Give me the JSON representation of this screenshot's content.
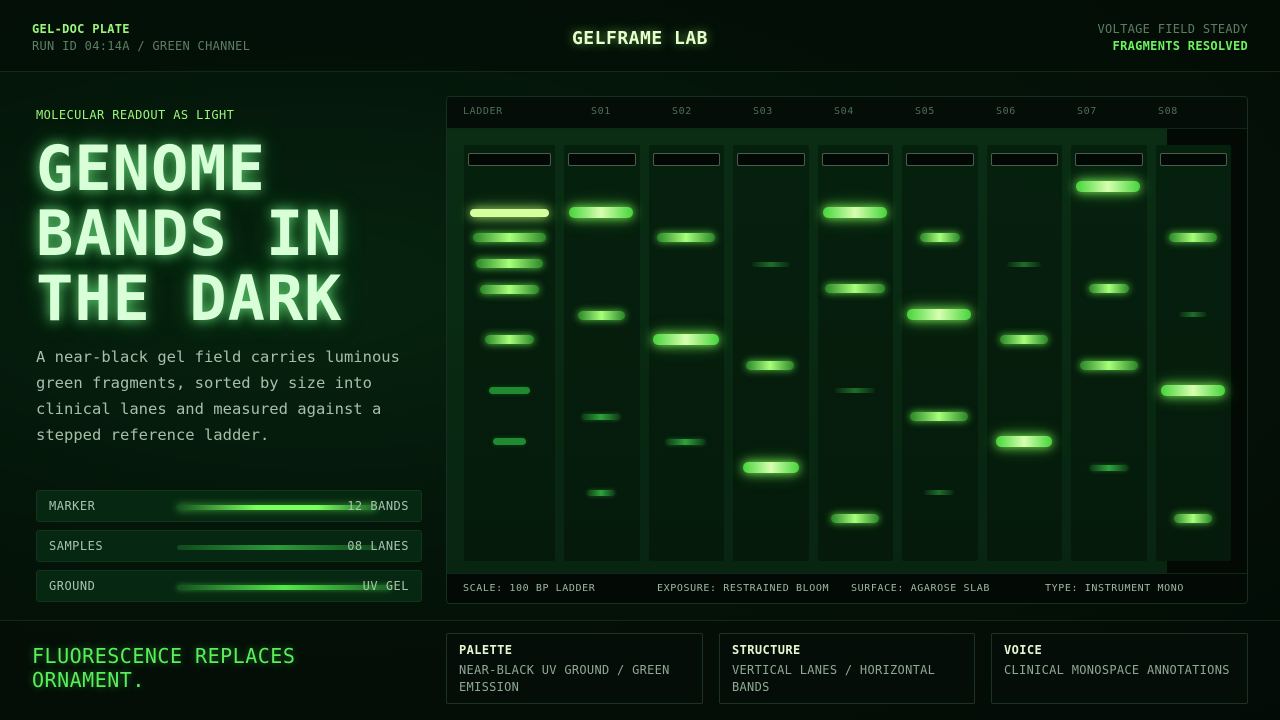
{
  "header": {
    "plate_label": "GEL-DOC PLATE",
    "run_id": "RUN ID 04:14A / GREEN CHANNEL",
    "brand": "GELFRAME LAB",
    "status_1": "VOLTAGE FIELD STEADY",
    "status_2": "FRAGMENTS RESOLVED"
  },
  "hero": {
    "eyebrow": "MOLECULAR READOUT AS LIGHT",
    "headline_1": "GENOME",
    "headline_2": "BANDS IN",
    "headline_3": "THE DARK",
    "description": "A near-black gel field carries luminous green fragments, sorted by size into clinical lanes and measured against a stepped reference ladder."
  },
  "metrics": [
    {
      "label": "MARKER",
      "value": "12 BANDS"
    },
    {
      "label": "SAMPLES",
      "value": "08 LANES"
    },
    {
      "label": "GROUND",
      "value": "UV GEL"
    }
  ],
  "gel": {
    "lanes": [
      "LADDER",
      "S01",
      "S02",
      "S03",
      "S04",
      "S05",
      "S06",
      "S07",
      "S08"
    ],
    "footer": {
      "scale": "SCALE: 100 BP LADDER",
      "exposure": "EXPOSURE: RESTRAINED BLOOM",
      "surface": "SURFACE: AGAROSE SLAB",
      "type": "TYPE: INSTRUMENT MONO"
    }
  },
  "footer": {
    "tagline": "FLUORESCENCE REPLACES ORNAMENT.",
    "cards": [
      {
        "title": "PALETTE",
        "body": "NEAR-BLACK UV GROUND / GREEN EMISSION"
      },
      {
        "title": "STRUCTURE",
        "body": "VERTICAL LANES / HORIZONTAL BANDS"
      },
      {
        "title": "VOICE",
        "body": "CLINICAL MONOSPACE ANNOTATIONS"
      }
    ]
  },
  "colors": {
    "background": "#041409",
    "emission_green": "#7bff5e",
    "accent_lime": "#9cf57a",
    "headline_glow": "#d8ffd8"
  }
}
